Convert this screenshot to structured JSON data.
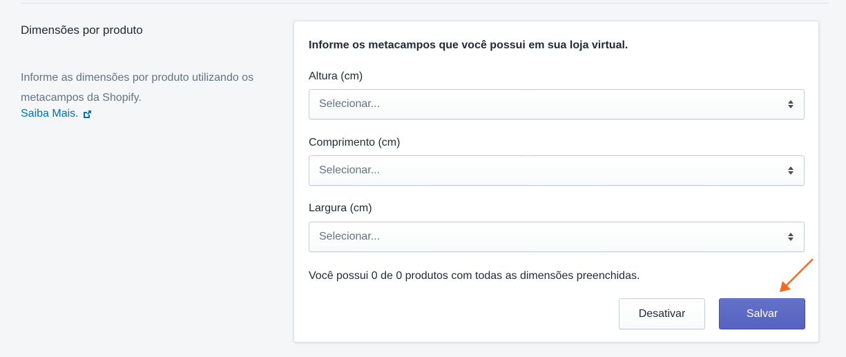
{
  "section": {
    "title": "Dimensões por produto",
    "description": "Informe as dimensões por produto utilizando os metacampos da Shopify.",
    "learn_more": "Saiba Mais."
  },
  "card": {
    "heading": "Informe os metacampos que você possui em sua loja virtual.",
    "fields": [
      {
        "label": "Altura (cm)",
        "value": "Selecionar..."
      },
      {
        "label": "Comprimento (cm)",
        "value": "Selecionar..."
      },
      {
        "label": "Largura (cm)",
        "value": "Selecionar..."
      }
    ],
    "summary": "Você possui 0 de 0 produtos com todas as dimensões preenchidas.",
    "disable_button": "Desativar",
    "save_button": "Salvar"
  },
  "icons": {
    "learn_more": "external-link-icon",
    "select": "select-arrows-icon",
    "annotation": "annotation-arrow-icon"
  },
  "colors": {
    "primary": "#5c6ac4",
    "link": "#006fbb",
    "annotation_arrow": "#f26b21"
  }
}
